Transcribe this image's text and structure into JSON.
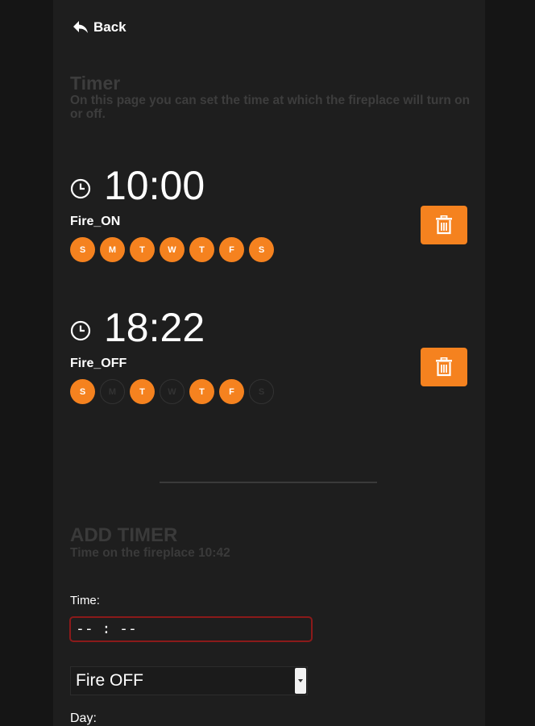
{
  "nav": {
    "back_label": "Back",
    "back_icon": "reply-arrow-icon"
  },
  "header": {
    "title": "Timer",
    "subtitle": "On this page you can set the time at which the fireplace will turn on or off."
  },
  "timers": [
    {
      "time": "10:00",
      "label": "Fire_ON",
      "days": [
        {
          "letter": "S",
          "active": true
        },
        {
          "letter": "M",
          "active": true
        },
        {
          "letter": "T",
          "active": true
        },
        {
          "letter": "W",
          "active": true
        },
        {
          "letter": "T",
          "active": true
        },
        {
          "letter": "F",
          "active": true
        },
        {
          "letter": "S",
          "active": true
        }
      ]
    },
    {
      "time": "18:22",
      "label": "Fire_OFF",
      "days": [
        {
          "letter": "S",
          "active": true
        },
        {
          "letter": "M",
          "active": false
        },
        {
          "letter": "T",
          "active": true
        },
        {
          "letter": "W",
          "active": false
        },
        {
          "letter": "T",
          "active": true
        },
        {
          "letter": "F",
          "active": true
        },
        {
          "letter": "S",
          "active": false
        }
      ]
    }
  ],
  "add_timer": {
    "title": "ADD TIMER",
    "subtitle": "Time on the fireplace 10:42",
    "time_label": "Time:",
    "time_value": "-- : --",
    "action_selected": "Fire OFF",
    "day_label": "Day:"
  },
  "colors": {
    "accent": "#f5821f",
    "background": "#1e1e1e",
    "input_border": "#8b1a1a"
  }
}
